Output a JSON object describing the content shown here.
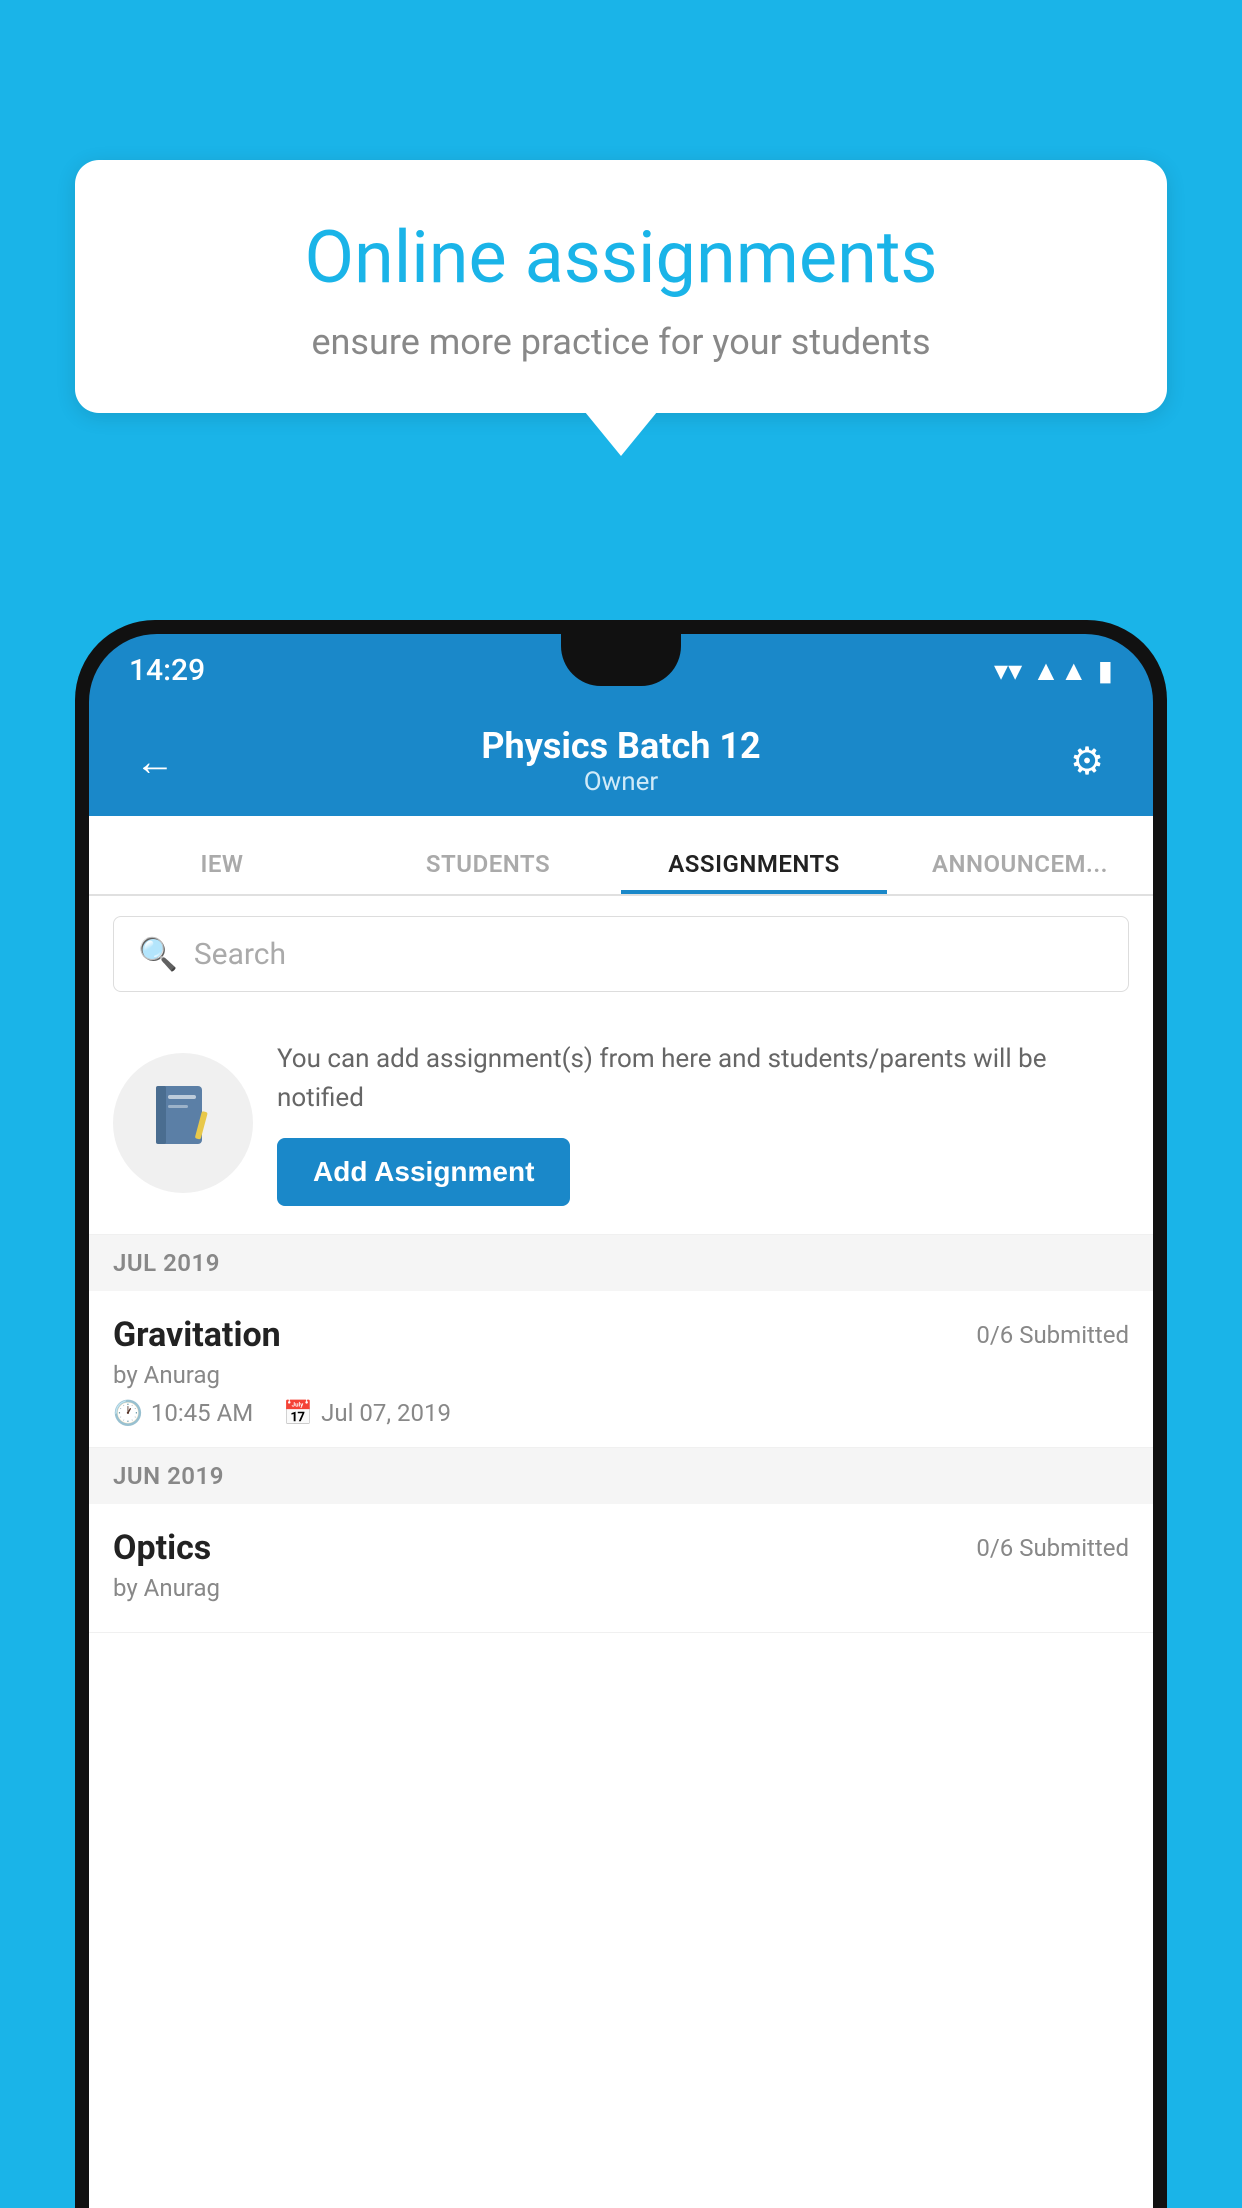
{
  "background_color": "#1ab4e8",
  "speech_bubble": {
    "title": "Online assignments",
    "subtitle": "ensure more practice for your students"
  },
  "status_bar": {
    "time": "14:29"
  },
  "app_header": {
    "title": "Physics Batch 12",
    "subtitle": "Owner",
    "back_icon": "←",
    "settings_icon": "⚙"
  },
  "tabs": [
    {
      "label": "IEW",
      "active": false
    },
    {
      "label": "STUDENTS",
      "active": false
    },
    {
      "label": "ASSIGNMENTS",
      "active": true
    },
    {
      "label": "ANNOUNCEM...",
      "active": false
    }
  ],
  "search": {
    "placeholder": "Search",
    "icon": "🔍"
  },
  "promo_card": {
    "description": "You can add assignment(s) from here and students/parents will be notified",
    "button_label": "Add Assignment",
    "icon": "📓"
  },
  "sections": [
    {
      "label": "JUL 2019",
      "assignments": [
        {
          "name": "Gravitation",
          "submitted": "0/6 Submitted",
          "author": "by Anurag",
          "time": "10:45 AM",
          "date": "Jul 07, 2019"
        }
      ]
    },
    {
      "label": "JUN 2019",
      "assignments": [
        {
          "name": "Optics",
          "submitted": "0/6 Submitted",
          "author": "by Anurag",
          "time": "",
          "date": ""
        }
      ]
    }
  ]
}
